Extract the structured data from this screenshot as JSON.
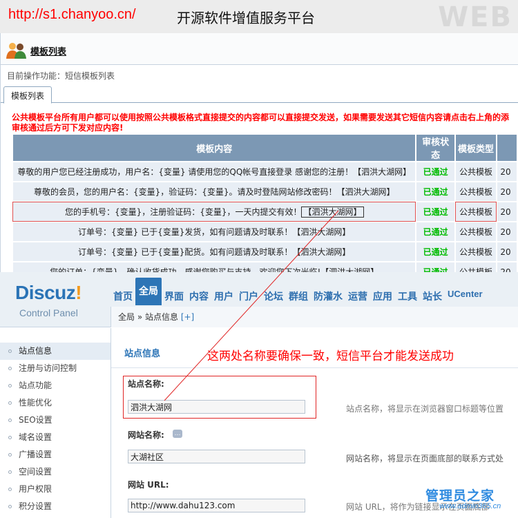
{
  "banner": {
    "url": "http://s1.chanyoo.cn/",
    "title": "开源软件增值服务平台",
    "watermark": "WEB"
  },
  "template_panel": {
    "title": "模板列表",
    "breadcrumb": "目前操作功能：短信模板列表",
    "tab": "模板列表",
    "notice_line1": "公共模板平台所有用户都可以使用按照公共模板格式直接提交的内容都可以直接提交发送，如果需要发送其它短信内容请点击右上角的添",
    "notice_line2": "审核通过后方可下发对应内容!",
    "columns": [
      "模板内容",
      "审核状态",
      "模板类型",
      ""
    ],
    "rows": [
      {
        "content": "尊敬的用户您已经注册成功，用户名：{变量} 请使用您的QQ帐号直接登录 感谢您的注册！【泗洪大湖网】",
        "status": "已通过",
        "type": "公共模板",
        "date": "20"
      },
      {
        "content": "尊敬的会员，您的用户名：{变量}，验证码：{变量}。请及时登陆网站修改密码！【泗洪大湖网】",
        "status": "已通过",
        "type": "公共模板",
        "date": "20"
      },
      {
        "content": "您的手机号：{变量}，注册验证码：{变量}，一天内提交有效！",
        "signature": "【泗洪大湖网】",
        "status": "已通过",
        "type": "公共模板",
        "date": "20"
      },
      {
        "content": "订单号：{变量} 已于{变量}发货，如有问题请及时联系！【泗洪大湖网】",
        "status": "已通过",
        "type": "公共模板",
        "date": "20"
      },
      {
        "content": "订单号：{变量} 已于{变量}配货。如有问题请及时联系！【泗洪大湖网】",
        "status": "已通过",
        "type": "公共模板",
        "date": "20"
      },
      {
        "content": "您的订单：{变量}，确认收货成功。感谢您购买与支持，欢迎您下次光临!【泗洪大湖网】",
        "status": "已通过",
        "type": "公共模板",
        "date": "20"
      }
    ],
    "colors": {
      "status": "#00bb00",
      "header": "#7c98b4",
      "notice": "#ff0000"
    }
  },
  "discuz": {
    "logo": "Discuz",
    "logo_mark": "!",
    "subtitle": "Control Panel",
    "nav": [
      "首页",
      "全局",
      "界面",
      "内容",
      "用户",
      "门户",
      "论坛",
      "群组",
      "防灌水",
      "运营",
      "应用",
      "工具",
      "站长",
      "UCenter"
    ],
    "nav_active": "全局",
    "crumbs": "全局 » 站点信息",
    "crumbs_plus": "[+]",
    "sidebar": [
      "站点信息",
      "注册与访问控制",
      "站点功能",
      "性能优化",
      "SEO设置",
      "域名设置",
      "广播设置",
      "空间设置",
      "用户权限",
      "积分设置"
    ],
    "section_title": "站点信息",
    "fields": {
      "site_name_label": "站点名称:",
      "site_name_value": "泗洪大湖网",
      "site_name_hint": "站点名称，将显示在浏览器窗口标题等位置",
      "web_name_label": "网站名称:",
      "web_name_value": "大湖社区",
      "web_name_hint": "网站名称，将显示在页面底部的联系方式处",
      "web_url_label": "网站 URL:",
      "web_url_value": "http://www.dahu123.com",
      "web_url_hint": "网站 URL，将作为链接显示在页面底部"
    }
  },
  "callout": "这两处名称要确保一致，短信平台才能发送成功",
  "watermark_logo": {
    "title": "管理员之家",
    "url": "www.admin365.cn"
  }
}
